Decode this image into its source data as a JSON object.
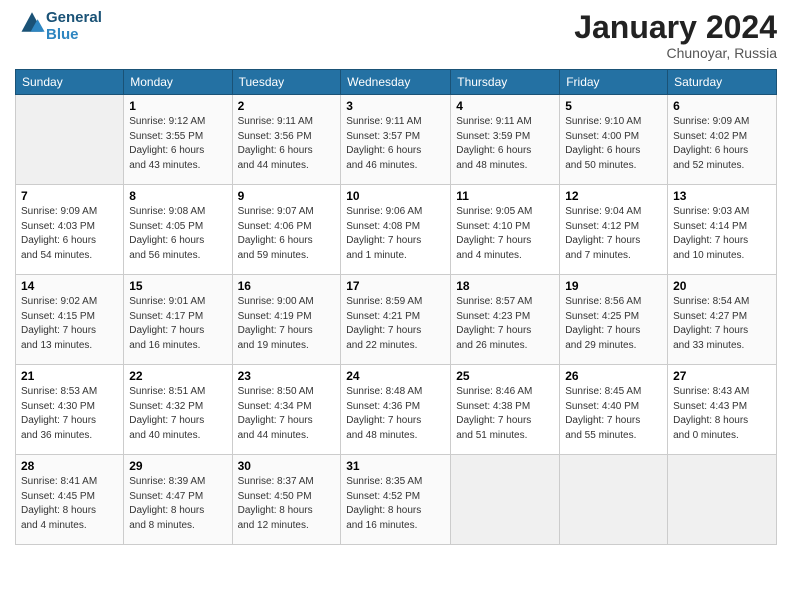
{
  "logo": {
    "text1": "General",
    "text2": "Blue"
  },
  "title": "January 2024",
  "location": "Chunoyar, Russia",
  "days_of_week": [
    "Sunday",
    "Monday",
    "Tuesday",
    "Wednesday",
    "Thursday",
    "Friday",
    "Saturday"
  ],
  "weeks": [
    [
      {
        "day": "",
        "info": ""
      },
      {
        "day": "1",
        "info": "Sunrise: 9:12 AM\nSunset: 3:55 PM\nDaylight: 6 hours\nand 43 minutes."
      },
      {
        "day": "2",
        "info": "Sunrise: 9:11 AM\nSunset: 3:56 PM\nDaylight: 6 hours\nand 44 minutes."
      },
      {
        "day": "3",
        "info": "Sunrise: 9:11 AM\nSunset: 3:57 PM\nDaylight: 6 hours\nand 46 minutes."
      },
      {
        "day": "4",
        "info": "Sunrise: 9:11 AM\nSunset: 3:59 PM\nDaylight: 6 hours\nand 48 minutes."
      },
      {
        "day": "5",
        "info": "Sunrise: 9:10 AM\nSunset: 4:00 PM\nDaylight: 6 hours\nand 50 minutes."
      },
      {
        "day": "6",
        "info": "Sunrise: 9:09 AM\nSunset: 4:02 PM\nDaylight: 6 hours\nand 52 minutes."
      }
    ],
    [
      {
        "day": "7",
        "info": "Sunrise: 9:09 AM\nSunset: 4:03 PM\nDaylight: 6 hours\nand 54 minutes."
      },
      {
        "day": "8",
        "info": "Sunrise: 9:08 AM\nSunset: 4:05 PM\nDaylight: 6 hours\nand 56 minutes."
      },
      {
        "day": "9",
        "info": "Sunrise: 9:07 AM\nSunset: 4:06 PM\nDaylight: 6 hours\nand 59 minutes."
      },
      {
        "day": "10",
        "info": "Sunrise: 9:06 AM\nSunset: 4:08 PM\nDaylight: 7 hours\nand 1 minute."
      },
      {
        "day": "11",
        "info": "Sunrise: 9:05 AM\nSunset: 4:10 PM\nDaylight: 7 hours\nand 4 minutes."
      },
      {
        "day": "12",
        "info": "Sunrise: 9:04 AM\nSunset: 4:12 PM\nDaylight: 7 hours\nand 7 minutes."
      },
      {
        "day": "13",
        "info": "Sunrise: 9:03 AM\nSunset: 4:14 PM\nDaylight: 7 hours\nand 10 minutes."
      }
    ],
    [
      {
        "day": "14",
        "info": "Sunrise: 9:02 AM\nSunset: 4:15 PM\nDaylight: 7 hours\nand 13 minutes."
      },
      {
        "day": "15",
        "info": "Sunrise: 9:01 AM\nSunset: 4:17 PM\nDaylight: 7 hours\nand 16 minutes."
      },
      {
        "day": "16",
        "info": "Sunrise: 9:00 AM\nSunset: 4:19 PM\nDaylight: 7 hours\nand 19 minutes."
      },
      {
        "day": "17",
        "info": "Sunrise: 8:59 AM\nSunset: 4:21 PM\nDaylight: 7 hours\nand 22 minutes."
      },
      {
        "day": "18",
        "info": "Sunrise: 8:57 AM\nSunset: 4:23 PM\nDaylight: 7 hours\nand 26 minutes."
      },
      {
        "day": "19",
        "info": "Sunrise: 8:56 AM\nSunset: 4:25 PM\nDaylight: 7 hours\nand 29 minutes."
      },
      {
        "day": "20",
        "info": "Sunrise: 8:54 AM\nSunset: 4:27 PM\nDaylight: 7 hours\nand 33 minutes."
      }
    ],
    [
      {
        "day": "21",
        "info": "Sunrise: 8:53 AM\nSunset: 4:30 PM\nDaylight: 7 hours\nand 36 minutes."
      },
      {
        "day": "22",
        "info": "Sunrise: 8:51 AM\nSunset: 4:32 PM\nDaylight: 7 hours\nand 40 minutes."
      },
      {
        "day": "23",
        "info": "Sunrise: 8:50 AM\nSunset: 4:34 PM\nDaylight: 7 hours\nand 44 minutes."
      },
      {
        "day": "24",
        "info": "Sunrise: 8:48 AM\nSunset: 4:36 PM\nDaylight: 7 hours\nand 48 minutes."
      },
      {
        "day": "25",
        "info": "Sunrise: 8:46 AM\nSunset: 4:38 PM\nDaylight: 7 hours\nand 51 minutes."
      },
      {
        "day": "26",
        "info": "Sunrise: 8:45 AM\nSunset: 4:40 PM\nDaylight: 7 hours\nand 55 minutes."
      },
      {
        "day": "27",
        "info": "Sunrise: 8:43 AM\nSunset: 4:43 PM\nDaylight: 8 hours\nand 0 minutes."
      }
    ],
    [
      {
        "day": "28",
        "info": "Sunrise: 8:41 AM\nSunset: 4:45 PM\nDaylight: 8 hours\nand 4 minutes."
      },
      {
        "day": "29",
        "info": "Sunrise: 8:39 AM\nSunset: 4:47 PM\nDaylight: 8 hours\nand 8 minutes."
      },
      {
        "day": "30",
        "info": "Sunrise: 8:37 AM\nSunset: 4:50 PM\nDaylight: 8 hours\nand 12 minutes."
      },
      {
        "day": "31",
        "info": "Sunrise: 8:35 AM\nSunset: 4:52 PM\nDaylight: 8 hours\nand 16 minutes."
      },
      {
        "day": "",
        "info": ""
      },
      {
        "day": "",
        "info": ""
      },
      {
        "day": "",
        "info": ""
      }
    ]
  ]
}
